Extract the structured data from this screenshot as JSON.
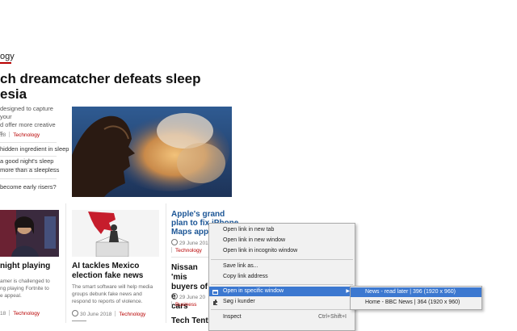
{
  "article": {
    "section": "ogy",
    "headline_line1": "ch dreamcatcher defeats sleep",
    "headline_line2": "esia",
    "summary": [
      "designed to capture your",
      "d offer more creative",
      "s"
    ],
    "date": "18",
    "tag": "Technology",
    "related": [
      "hidden ingredient in sleep",
      "a good night's sleep",
      "more than a sleepless",
      "become early risers?"
    ]
  },
  "cards": {
    "left": {
      "title_line1": "night playing",
      "title_line2": "",
      "summary": [
        "amer is challenged to",
        "ng playing Fortnite to",
        "e appeal."
      ],
      "date": "18",
      "tag": "Technology"
    },
    "middle": {
      "title_line1": "AI tackles Mexico",
      "title_line2": "election fake news",
      "summary": [
        "The smart software will help media",
        "groups debunk fake news and",
        "respond to reports of violence."
      ],
      "date": "30 June 2018",
      "tag": "Technology"
    },
    "right_top": {
      "title": [
        "Apple's grand",
        "plan to fix iPhone",
        "Maps app"
      ],
      "date": "29 June 2018",
      "tag": "Technology"
    },
    "right_mid": {
      "title": [
        "Nissan 'mis",
        "buyers of e",
        "cars"
      ],
      "date": "29 June 20",
      "tag": "Business"
    },
    "right_bottom": {
      "title": "Tech Tent:"
    }
  },
  "context_menu": {
    "items": [
      {
        "label": "Open link in new tab"
      },
      {
        "label": "Open link in new window"
      },
      {
        "label": "Open link in incognito window"
      },
      {
        "label": "Save link as..."
      },
      {
        "label": "Copy link address"
      },
      {
        "label": "Open in specific window"
      },
      {
        "label": "Søg i kunder"
      },
      {
        "label": "Inspect",
        "shortcut": "Ctrl+Shift+I"
      }
    ],
    "arrow": "▶"
  },
  "submenu": {
    "items": [
      {
        "label": "News - read later | 396 (1920 x 960)"
      },
      {
        "label": "Home - BBC News | 364 (1920 x 960)"
      }
    ]
  },
  "colors": {
    "accent_red": "#b80000",
    "link_blue": "#1c5696",
    "menu_highlight": "#3c78d0"
  }
}
